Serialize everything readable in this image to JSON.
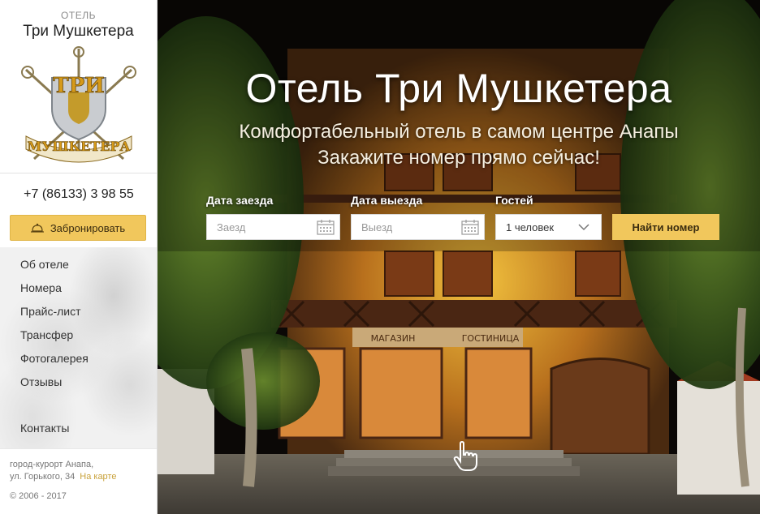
{
  "sidebar": {
    "subtitle": "ОТЕЛЬ",
    "hotel_name": "Три Мушкетера",
    "logo_text_top": "ТРИ",
    "logo_text_bottom": "МУШКЕТЕРА",
    "phone": "+7 (86133) 3 98 55",
    "book_label": "Забронировать",
    "nav": [
      "Об отеле",
      "Номера",
      "Прайс-лист",
      "Трансфер",
      "Фотогалерея",
      "Отзывы"
    ],
    "contacts": "Контакты",
    "address_line1": "город-курорт Анапа,",
    "address_line2": "ул. Горького, 34",
    "map_link": "На карте",
    "copyright": "© 2006 - 2017"
  },
  "hero": {
    "title": "Отель Три Мушкетера",
    "subtitle1": "Комфортабельный отель в самом центре Анапы",
    "subtitle2": "Закажите номер прямо сейчас!",
    "sign_left": "МАГАЗИН",
    "sign_right": "ГОСТИНИЦА"
  },
  "booking": {
    "checkin_label": "Дата заезда",
    "checkin_placeholder": "Заезд",
    "checkout_label": "Дата выезда",
    "checkout_placeholder": "Выезд",
    "guests_label": "Гостей",
    "guests_value": "1 человек",
    "search_label": "Найти номер"
  },
  "colors": {
    "accent": "#f1c75c",
    "link": "#c9a23b"
  }
}
